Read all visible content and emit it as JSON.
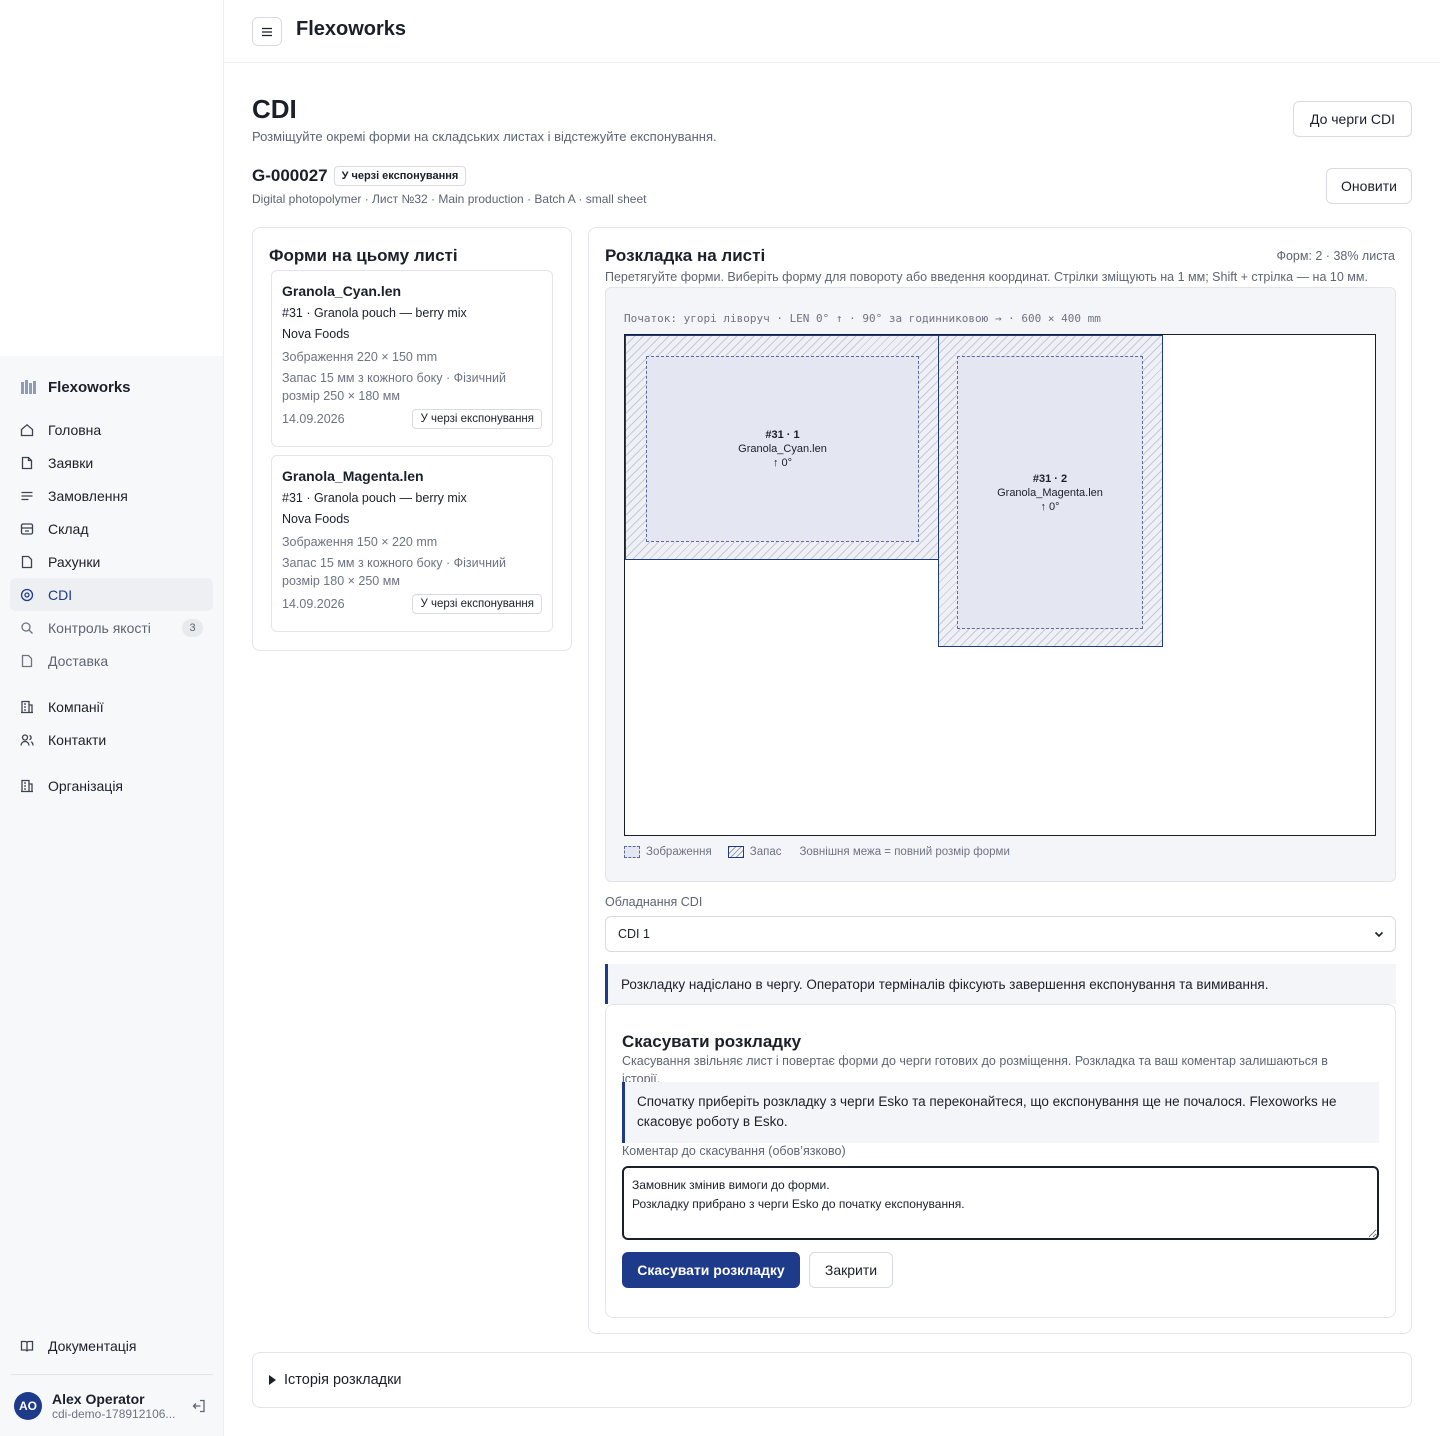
{
  "app": {
    "name": "Flexoworks",
    "topbar_title": "Flexoworks"
  },
  "sidebar": {
    "brand": "Flexoworks",
    "items": [
      {
        "label": "Головна",
        "icon": "home-icon"
      },
      {
        "label": "Заявки",
        "icon": "document-icon"
      },
      {
        "label": "Замовлення",
        "icon": "list-icon"
      },
      {
        "label": "Склад",
        "icon": "warehouse-icon"
      },
      {
        "label": "Рахунки",
        "icon": "invoice-icon"
      },
      {
        "label": "CDI",
        "icon": "target-icon",
        "active": true
      },
      {
        "label": "Контроль якості",
        "icon": "search-icon",
        "badge": "3"
      },
      {
        "label": "Доставка",
        "icon": "truck-icon"
      },
      {
        "label": "Компанії",
        "icon": "building-icon"
      },
      {
        "label": "Контакти",
        "icon": "users-icon"
      },
      {
        "label": "Організація",
        "icon": "org-icon"
      }
    ],
    "docs": "Документація",
    "user": {
      "initials": "AO",
      "name": "Alex Operator",
      "email": "cdi-demo-178912106..."
    }
  },
  "page": {
    "title": "CDI",
    "subtitle": "Розміщуйте окремі форми на складських листах і відстежуйте експонування.",
    "queue_button": "До черги CDI",
    "refresh_button": "Оновити",
    "sheet_id": "G-000027",
    "sheet_status": "У черзі експонування",
    "sheet_meta": "Digital photopolymer · Лист №32 · Main production · Batch A · small sheet"
  },
  "forms": {
    "title": "Форми на цьому листі",
    "items": [
      {
        "name": "Granola_Cyan.len",
        "order": "#31 · Granola pouch — berry mix",
        "client": "Nova Foods",
        "image": "Зображення 220 × 150 mm",
        "margin": "Запас 15 мм з кожного боку · Фізичний розмір 250 × 180 мм",
        "date": "14.09.2026",
        "status": "У черзі експонування"
      },
      {
        "name": "Granola_Magenta.len",
        "order": "#31 · Granola pouch — berry mix",
        "client": "Nova Foods",
        "image": "Зображення 150 × 220 mm",
        "margin": "Запас 15 мм з кожного боку · Фізичний розмір 180 × 250 мм",
        "date": "14.09.2026",
        "status": "У черзі експонування"
      }
    ]
  },
  "layout": {
    "title": "Розкладка на листі",
    "stat": "Форм: 2 · 38% листа",
    "hint": "Перетягуйте форми. Виберіть форму для повороту або введення координат. Стрілки зміщують на 1 мм; Shift + стрілка — на 10 мм.",
    "caption": "Початок: угорі ліворуч · LEN 0° ↑ · 90° за годинниковою → · 600 × 400 mm",
    "plates": [
      {
        "num": "#31 · 1",
        "name": "Granola_Cyan.len",
        "rotation": "↑ 0°"
      },
      {
        "num": "#31 · 2",
        "name": "Granola_Magenta.len",
        "rotation": "↑ 0°"
      }
    ],
    "legend": {
      "image": "Зображення",
      "margin": "Запас",
      "outer": "Зовнішня межа = повний розмір форми"
    },
    "equipment_label": "Обладнання CDI",
    "equipment_value": "CDI 1",
    "notice": "Розкладку надіслано в чергу. Оператори терміналів фіксують завершення експонування та вимивання."
  },
  "cancel": {
    "title": "Скасувати розкладку",
    "description": "Скасування звільняє лист і повертає форми до черги готових до розміщення. Розкладка та ваш коментар залишаються в історії.",
    "warning": "Спочатку приберіть розкладку з черги Esko та переконайтеся, що експонування ще не почалося. Flexoworks не скасовує роботу в Esko.",
    "comment_label": "Коментар до скасування (обов’язково)",
    "comment_value": "Замовник змінив вимоги до форми.\nРозкладку прибрано з черги Esko до початку експонування.",
    "submit": "Скасувати розкладку",
    "close": "Закрити"
  },
  "history": {
    "label": "Історія розкладки"
  },
  "colors": {
    "accent": "#1e3a8a",
    "border": "#e3e5ea",
    "muted": "#5e6472"
  }
}
